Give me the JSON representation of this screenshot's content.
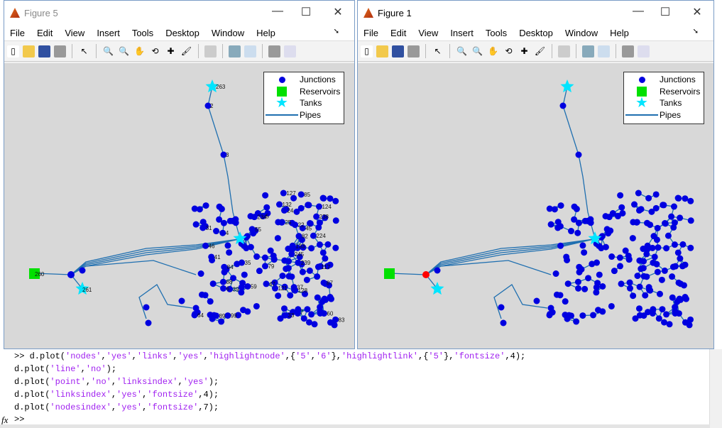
{
  "windows": [
    {
      "title": "Figure 5",
      "highlight": false
    },
    {
      "title": "Figure 1",
      "highlight": true
    }
  ],
  "menu": [
    "File",
    "Edit",
    "View",
    "Insert",
    "Tools",
    "Desktop",
    "Window",
    "Help"
  ],
  "toolbar_icons": [
    "new-file-icon",
    "open-folder-icon",
    "save-icon",
    "print-icon",
    "pointer-icon",
    "zoom-in-icon",
    "zoom-out-icon",
    "pan-icon",
    "rotate-icon",
    "data-cursor-icon",
    "brush-icon",
    "link-icon",
    "colorbar-icon",
    "legend-icon",
    "hide-plot-tools-icon",
    "show-plot-tools-icon"
  ],
  "legend": {
    "junctions": "Junctions",
    "reservoirs": "Reservoirs",
    "tanks": "Tanks",
    "pipes": "Pipes"
  },
  "colors": {
    "junction": "#0000e0",
    "reservoir": "#00e000",
    "tank": "#00e5ff",
    "pipe": "#1f6fb0",
    "highlight": "#ff0000"
  },
  "figure5_labels": {
    "tank_top": "263",
    "node2": "2",
    "node3": "3",
    "reservoir": "260",
    "tank_left": "261",
    "cluster": [
      "64",
      "59",
      "60",
      "31",
      "55",
      "47",
      "46",
      "45",
      "41",
      "84",
      "83",
      "82",
      "79",
      "85",
      "87",
      "88",
      "89",
      "99",
      "121",
      "128",
      "117",
      "124",
      "127",
      "132",
      "133",
      "238",
      "239",
      "245",
      "224",
      "234",
      "35",
      "22",
      "24",
      "25",
      "33",
      "37",
      "39",
      "4",
      "5",
      "6",
      "7"
    ]
  },
  "command": {
    "lines": [
      [
        ">> d.plot(",
        [
          "'nodes'"
        ],
        ",",
        [
          "'yes'"
        ],
        ",",
        [
          "'links'"
        ],
        ",",
        [
          "'yes'"
        ],
        ",",
        [
          "'highlightnode'"
        ],
        ",{",
        [
          "'5'"
        ],
        ",",
        [
          "'6'"
        ],
        "},",
        [
          "'highlightlink'"
        ],
        ",{",
        [
          "'5'"
        ],
        "},",
        [
          "'fontsize'"
        ],
        ",4);"
      ],
      [
        "d.plot(",
        [
          "'line'"
        ],
        ",",
        [
          "'no'"
        ],
        ");"
      ],
      [
        "d.plot(",
        [
          "'point'"
        ],
        ",",
        [
          "'no'"
        ],
        ",",
        [
          "'linksindex'"
        ],
        ",",
        [
          "'yes'"
        ],
        ");"
      ],
      [
        "d.plot(",
        [
          "'linksindex'"
        ],
        ",",
        [
          "'yes'"
        ],
        ",",
        [
          "'fontsize'"
        ],
        ",4);"
      ],
      [
        "d.plot(",
        [
          "'nodesindex'"
        ],
        ",",
        [
          "'yes'"
        ],
        ",",
        [
          "'fontsize'"
        ],
        ",7);"
      ]
    ],
    "prompt": ">>",
    "fx": "fx"
  }
}
